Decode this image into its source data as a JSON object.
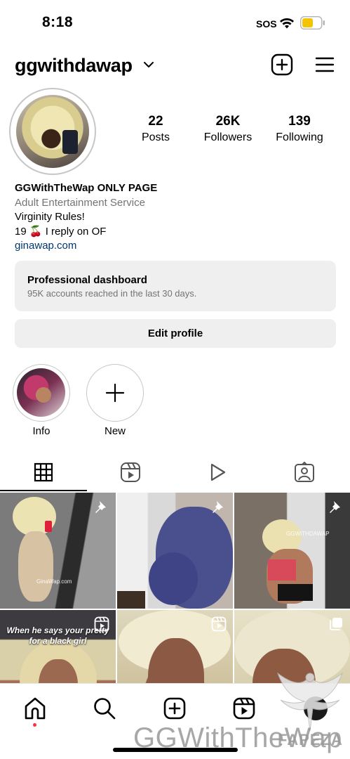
{
  "status": {
    "time": "8:18",
    "carrier": "SOS",
    "battery_color": "#f5c400"
  },
  "header": {
    "username": "ggwithdawap"
  },
  "profile": {
    "stats": [
      {
        "value": "22",
        "label": "Posts"
      },
      {
        "value": "26K",
        "label": "Followers"
      },
      {
        "value": "139",
        "label": "Following"
      }
    ],
    "bio": {
      "name": "GGWithTheWap ONLY PAGE",
      "category": "Adult Entertainment Service",
      "line1": "Virginity Rules!",
      "line2": "19 🍒 I reply on OF",
      "link": "ginawap.com"
    }
  },
  "dashboard": {
    "title": "Professional dashboard",
    "subtitle": "95K accounts reached in the last 30 days."
  },
  "edit_profile_label": "Edit profile",
  "highlights": [
    {
      "label": "Info"
    },
    {
      "label": "New"
    }
  ],
  "tabs": [
    {
      "icon": "grid-icon"
    },
    {
      "icon": "reels-icon"
    },
    {
      "icon": "play-icon"
    },
    {
      "icon": "tagged-icon"
    }
  ],
  "grid": {
    "post4_caption": "When he says your pretty for a black girl",
    "post1_watermark": "GinaWap.com",
    "post3_watermark": "GGWITHDAWAP"
  },
  "nav": {
    "items": [
      "home-icon",
      "search-icon",
      "create-icon",
      "reels-icon",
      "profile-icon"
    ],
    "accent": "#ff3040"
  },
  "watermark": {
    "text": "GGWithTheWap",
    "brand": "FAPEZA"
  }
}
